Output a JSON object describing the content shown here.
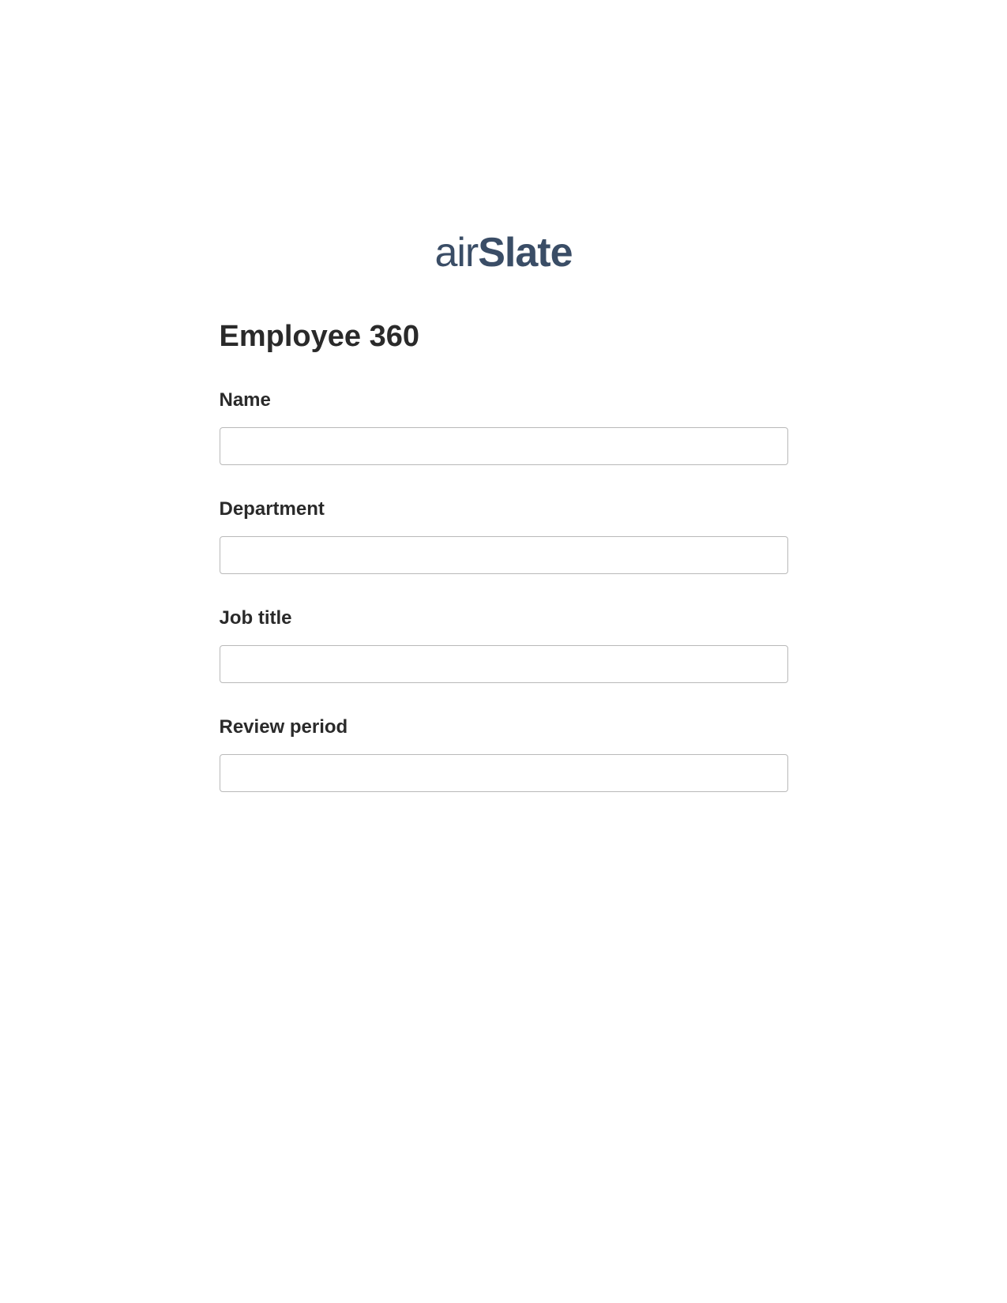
{
  "logo": {
    "prefix": "air",
    "suffix": "Slate"
  },
  "form": {
    "title": "Employee 360",
    "fields": [
      {
        "label": "Name",
        "value": ""
      },
      {
        "label": "Department",
        "value": ""
      },
      {
        "label": "Job title",
        "value": ""
      },
      {
        "label": "Review period",
        "value": ""
      }
    ]
  }
}
